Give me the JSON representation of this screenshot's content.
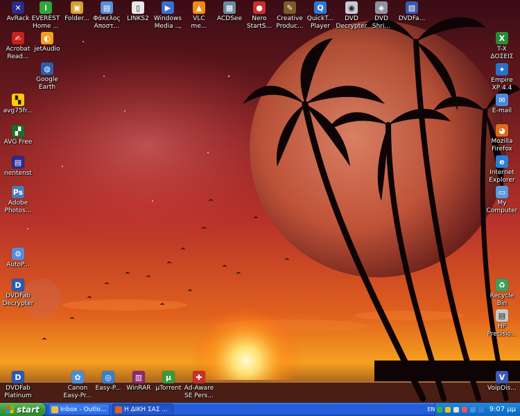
{
  "desktop": {
    "icons": [
      {
        "id": "avrack",
        "label": "AvRack",
        "color": "#2b2b8a",
        "glyph": "✕"
      },
      {
        "id": "everest",
        "label": "EVEREST\nHome ...",
        "color": "#2fa63a",
        "glyph": "i"
      },
      {
        "id": "folder",
        "label": "Folder...",
        "color": "#d7a02a",
        "glyph": "▣"
      },
      {
        "id": "fakelos",
        "label": "Φάκελος\nΑποστ...",
        "color": "#5b8fd6",
        "glyph": "▤"
      },
      {
        "id": "links2",
        "label": "LINKS2",
        "color": "#e8e8e8",
        "glyph": "▯"
      },
      {
        "id": "wmp",
        "label": "Windows\nMedia ...",
        "color": "#3a6fd0",
        "glyph": "▶"
      },
      {
        "id": "vlc",
        "label": "VLC\nme...",
        "color": "#f28a10",
        "glyph": "▲"
      },
      {
        "id": "acdsee",
        "label": "ACDSee",
        "color": "#6b8aa0",
        "glyph": "▦"
      },
      {
        "id": "nero",
        "label": "Nero\nStartS...",
        "color": "#c9302c",
        "glyph": "●"
      },
      {
        "id": "creative",
        "label": "Creative\nProduc...",
        "color": "#7a5b2a",
        "glyph": "✎"
      },
      {
        "id": "quicktime",
        "label": "QuickT...\nPlayer",
        "color": "#2e76d6",
        "glyph": "Q"
      },
      {
        "id": "dvd-decrypter-top",
        "label": "DVD\nDecrypter",
        "color": "#c8c8d8",
        "glyph": "◉"
      },
      {
        "id": "dvd-shrink",
        "label": "DVD\nShri...",
        "color": "#9090a0",
        "glyph": "◈"
      },
      {
        "id": "dvdfab-top",
        "label": "DVDFa...",
        "color": "#3a5aa8",
        "glyph": "▧"
      },
      {
        "id": "acrobat",
        "label": "Acrobat\nRead...",
        "color": "#c8201c",
        "glyph": "✍"
      },
      {
        "id": "jetaudio",
        "label": "jetAudio",
        "color": "#f2a11a",
        "glyph": "◐"
      },
      {
        "id": "google-earth",
        "label": "Google\nEarth",
        "color": "#2a5fb0",
        "glyph": "◍"
      },
      {
        "id": "avg75",
        "label": "avg75fr...",
        "color": "#ffcc00",
        "glyph": "▚"
      },
      {
        "id": "avg-free",
        "label": "AVG Free",
        "color": "#1a6e2a",
        "glyph": "▞"
      },
      {
        "id": "nentenst",
        "label": "nentenst",
        "color": "#2a2a90",
        "glyph": "▤"
      },
      {
        "id": "adobe-photoshop",
        "label": "Adobe\nPhotos...",
        "color": "#4a7ab8",
        "glyph": "Ps"
      },
      {
        "id": "autop",
        "label": "AutoP...",
        "color": "#5a8ad8",
        "glyph": "⚙"
      },
      {
        "id": "dvdfab-decrypter",
        "label": "DVDFab\nDecrypter",
        "color": "#2a5ab0",
        "glyph": "D"
      },
      {
        "id": "dvdfab-platinum",
        "label": "DVDFab\nPlatinum",
        "color": "#2a5ab0",
        "glyph": "D"
      },
      {
        "id": "canon",
        "label": "Canon\nEasy-Pr...",
        "color": "#4a90d8",
        "glyph": "✿"
      },
      {
        "id": "easyp",
        "label": "Easy-P...",
        "color": "#3a80c8",
        "glyph": "◎"
      },
      {
        "id": "winrar",
        "label": "WinRAR",
        "color": "#8a2a6a",
        "glyph": "▥"
      },
      {
        "id": "utorrent",
        "label": "µTorrent",
        "color": "#3a9a3a",
        "glyph": "µ"
      },
      {
        "id": "adaware",
        "label": "Ad-Aware\nSE Pers...",
        "color": "#c8302a",
        "glyph": "✚"
      },
      {
        "id": "tx-doseis",
        "label": "T-X\nΔΟΣΕΙΣ",
        "color": "#2a8a3a",
        "glyph": "X"
      },
      {
        "id": "empire",
        "label": "Empire\nXP 4.4",
        "color": "#2a70c8",
        "glyph": "✦"
      },
      {
        "id": "email",
        "label": "E-mail",
        "color": "#4a8ad8",
        "glyph": "✉"
      },
      {
        "id": "firefox",
        "label": "Mozilla\nFirefox",
        "color": "#e06a1a",
        "glyph": "◕"
      },
      {
        "id": "ie",
        "label": "Internet\nExplorer",
        "color": "#2a80d8",
        "glyph": "e"
      },
      {
        "id": "my-computer",
        "label": "My\nComputer",
        "color": "#5a9ad8",
        "glyph": "▭"
      },
      {
        "id": "recycle-bin",
        "label": "Recycle\nBin",
        "color": "#3aa05a",
        "glyph": "♻"
      },
      {
        "id": "hp-precision",
        "label": "HP\nPrecisio...",
        "color": "#c8c8c8",
        "glyph": "▤"
      },
      {
        "id": "voipdis",
        "label": "VoipDis...",
        "color": "#3a5ab8",
        "glyph": "V"
      }
    ]
  },
  "taskbar": {
    "start_label": "start",
    "tasks": [
      {
        "label": "Inbox - Outlo...",
        "color": "#e8c040",
        "active": false
      },
      {
        "label": "Η ΔΙΚΗ ΣΑΣ ...",
        "color": "#e06020",
        "active": true
      }
    ],
    "language": "EN",
    "clock": "9:07 μμ",
    "tray_colors": [
      "#44aa44",
      "#f0c020",
      "#dddddd",
      "#ff5050",
      "#4a90e0",
      "#3a80d0"
    ]
  },
  "colors": {
    "sky_top": "#3a0c14",
    "sky_mid": "#b8322a",
    "horizon": "#f6a020",
    "sun": "#fff3a0",
    "planet": "#c86a4a"
  }
}
